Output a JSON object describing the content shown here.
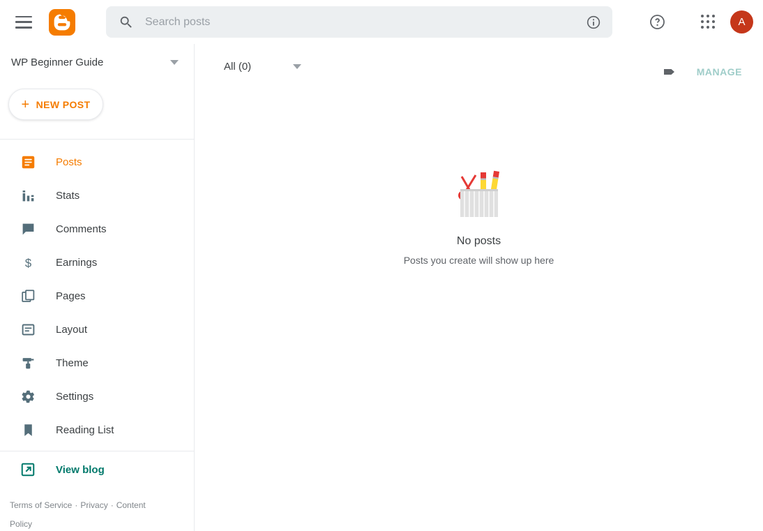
{
  "header": {
    "menu_icon": "hamburger-menu-icon",
    "logo_icon": "blogger-logo-icon",
    "search": {
      "placeholder": "Search posts",
      "value": "",
      "icon": "search-icon",
      "info_icon": "info-circle-icon"
    },
    "help_icon": "help-circle-icon",
    "apps_icon": "apps-grid-icon",
    "avatar_initial": "A"
  },
  "sidebar": {
    "blog_title": "WP Beginner Guide",
    "blog_switch_icon": "chevron-down-icon",
    "new_post_label": "NEW POST",
    "new_post_plus": "+",
    "items": [
      {
        "label": "Posts",
        "icon": "posts-icon",
        "active": true
      },
      {
        "label": "Stats",
        "icon": "stats-bar-chart-icon",
        "active": false
      },
      {
        "label": "Comments",
        "icon": "comment-bubble-icon",
        "active": false
      },
      {
        "label": "Earnings",
        "icon": "dollar-sign-icon",
        "active": false
      },
      {
        "label": "Pages",
        "icon": "pages-copy-icon",
        "active": false
      },
      {
        "label": "Layout",
        "icon": "layout-icon",
        "active": false
      },
      {
        "label": "Theme",
        "icon": "paint-roller-icon",
        "active": false
      },
      {
        "label": "Settings",
        "icon": "gear-icon",
        "active": false
      },
      {
        "label": "Reading List",
        "icon": "bookmark-icon",
        "active": false
      }
    ],
    "view_blog": {
      "label": "View blog",
      "icon": "external-link-icon"
    },
    "footer": {
      "terms": "Terms of Service",
      "privacy": "Privacy",
      "content_policy": "Content Policy",
      "separator": "·"
    }
  },
  "main": {
    "filter": {
      "label": "All (0)",
      "caret_icon": "chevron-down-icon"
    },
    "label_icon": "label-tag-icon",
    "manage_label": "MANAGE",
    "empty_state": {
      "illustration": "pencil-cup-illustration",
      "title": "No posts",
      "subtitle": "Posts you create will show up here"
    }
  },
  "colors": {
    "brand_orange": "#f57c00",
    "icon_gray": "#546e7a",
    "text_primary": "#3c4043",
    "text_secondary": "#5f6368",
    "teal": "#00796b",
    "manage_disabled": "#9fcdc9",
    "avatar_red": "#c5371a",
    "search_bg": "#eceff1"
  }
}
